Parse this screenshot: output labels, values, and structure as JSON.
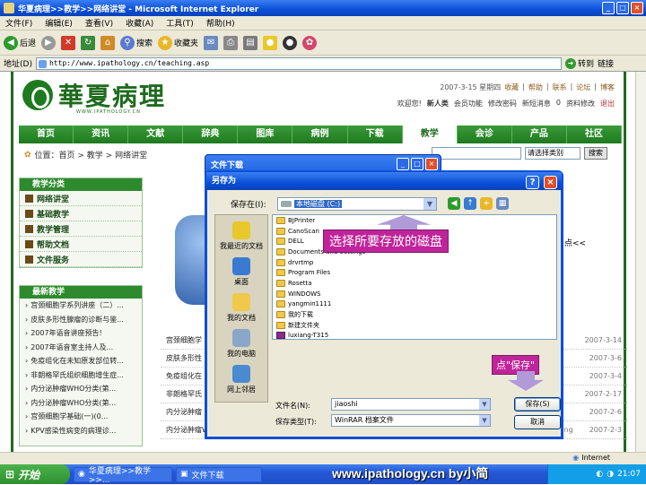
{
  "window": {
    "title": "华夏病理>>教学>>网络讲堂 - Microsoft Internet Explorer"
  },
  "menu": [
    "文件(F)",
    "编辑(E)",
    "查看(V)",
    "收藏(A)",
    "工具(T)",
    "帮助(H)"
  ],
  "toolbar": {
    "back": "后退",
    "search": "搜索",
    "favorites": "收藏夹"
  },
  "address": {
    "label": "地址(D)",
    "url": "http://www.ipathology.cn/teaching.asp",
    "go": "转到",
    "links": "链接"
  },
  "site": {
    "logo_text": "華夏病理",
    "logo_sub": "WWW.IPATHOLOGY.CN",
    "date": "2007-3-15 星期四",
    "toplinks": [
      "收藏",
      "帮助",
      "联系",
      "论坛",
      "博客"
    ],
    "userlinks": [
      "欢迎您!",
      "新人类",
      "会员功能",
      "修改密码",
      "新短消息",
      "0",
      "资料修改",
      "退出"
    ],
    "nav": [
      "首页",
      "资讯",
      "文献",
      "辞典",
      "图库",
      "病例",
      "下载",
      "教学",
      "会诊",
      "产品",
      "社区"
    ],
    "crumb": "位置：首页 > 教学 > 网络讲堂",
    "search_select": "请选择类别",
    "search_btn": "搜索",
    "sidebar_teach": {
      "title": "教学分类",
      "items": [
        "网络讲堂",
        "基础教学",
        "教学管理",
        "帮助文档",
        "文件服务"
      ]
    },
    "sidebar_latest": {
      "title": "最新教学",
      "items": [
        "宫颈细胞学系列讲座（二）...",
        "皮肤多形性腺瘤的诊断与鉴...",
        "2007年语音讲座预告!",
        "2007年语音室主持人及...",
        "免疫组化在未知原发部位转...",
        "非朗格罕氏组织细胞增生症...",
        "内分泌肿瘤WHO分类(第...",
        "内分泌肿瘤WHO分类(第...",
        "宫颈细胞学基础(一)(0...",
        "KPV感染性病变的病理诊..."
      ]
    },
    "main_list": [
      {
        "title": "宫颈细胞学",
        "date": "2007-3-14"
      },
      {
        "title": "皮肤多形性",
        "date": "2007-3-6"
      },
      {
        "title": "免疫组化在",
        "date": "2007-3-4"
      },
      {
        "title": "非朗格罕氏",
        "date": "2007-2-17"
      },
      {
        "title": "内分泌肿瘤",
        "date": "2007-2-6"
      },
      {
        "title": "内分泌肿瘤WHO分类(第1讲)（07-2-6）",
        "author": "Chiang",
        "date": "2007-2-3"
      }
    ],
    "arrow_text": "点<<"
  },
  "download_window": {
    "title": "文件下载"
  },
  "save_dialog": {
    "title": "另存为",
    "save_in_label": "保存在(I):",
    "save_in_value": "本地磁盘 (C:)",
    "places": [
      "我最近的文档",
      "桌面",
      "我的文档",
      "我的电脑",
      "网上邻居"
    ],
    "files": [
      {
        "name": "BJPrinter",
        "type": "folder"
      },
      {
        "name": "CanoScan",
        "type": "folder"
      },
      {
        "name": "DELL",
        "type": "folder"
      },
      {
        "name": "Documents and Settings",
        "type": "folder"
      },
      {
        "name": "drvrtmp",
        "type": "folder"
      },
      {
        "name": "Program Files",
        "type": "folder"
      },
      {
        "name": "Rosetta",
        "type": "folder"
      },
      {
        "name": "WINDOWS",
        "type": "folder"
      },
      {
        "name": "yangmin1111",
        "type": "folder"
      },
      {
        "name": "我的下载",
        "type": "folder"
      },
      {
        "name": "新建文件夹",
        "type": "folder"
      },
      {
        "name": "luxiang-T315",
        "type": "rar"
      }
    ],
    "filename_label": "文件名(N):",
    "filename_value": "jiaoshi",
    "filetype_label": "保存类型(T):",
    "filetype_value": "WinRAR 档案文件",
    "save_btn": "保存(S)",
    "cancel_btn": "取消"
  },
  "annotations": {
    "select_disk": "选择所要存放的磁盘",
    "click_save": "点\"保存\""
  },
  "status": {
    "zone": "Internet"
  },
  "taskbar": {
    "start": "开始",
    "tasks": [
      "华夏病理>>教学>>...",
      "文件下载"
    ],
    "clock": "21:07"
  },
  "credit": "www.ipathology.cn  by小简"
}
